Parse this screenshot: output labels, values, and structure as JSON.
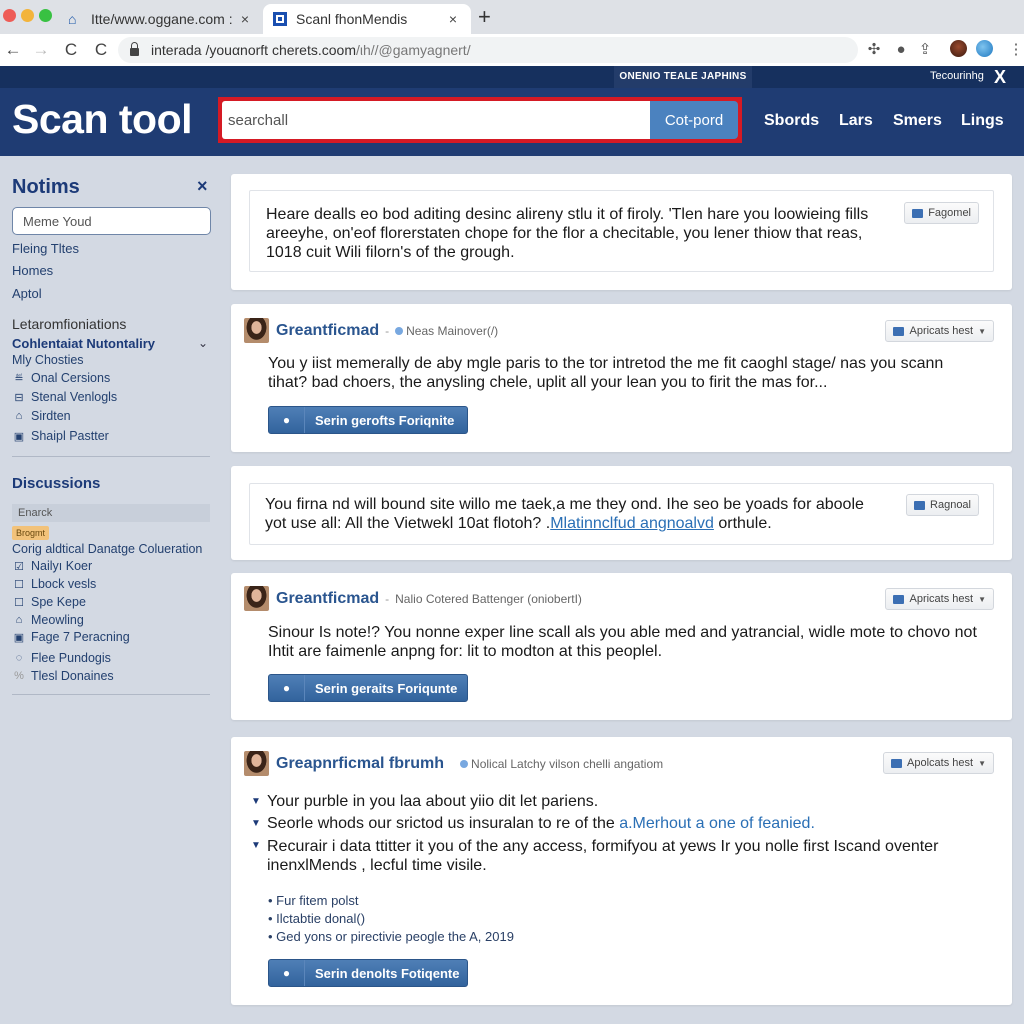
{
  "browser": {
    "tabs": [
      {
        "title": "Itte/www.oggane.com :",
        "icon": "home-icon",
        "active": false
      },
      {
        "title": "Scanl fhonMendis",
        "icon": "site-favicon",
        "active": true
      }
    ],
    "new_tab_label": "+",
    "close_label": "×",
    "url_main": "interada /youαnorft cherets.coom",
    "url_muted": "/ιh//@gamyagnert/",
    "nav": {
      "back": "←",
      "forward": "→",
      "reload": "C",
      "reload2": "C"
    },
    "extensions": [
      "puzzle-icon",
      "person-icon",
      "share-icon",
      "profile-avatar",
      "globe-icon",
      "menu-icon"
    ]
  },
  "topstrip": {
    "label": "ONENIO TEALE JAPHINS",
    "right_text": "Tecourinhg",
    "close": "X"
  },
  "header": {
    "brand": "Scan tool",
    "search_value": "searchall",
    "search_button": "Cot-pord",
    "nav": [
      "Sbords",
      "Lars",
      "Smers",
      "Lings"
    ],
    "highlight_color": "#d51a24",
    "brand_color": "#1f3c73"
  },
  "sidebar": {
    "title": "Notims",
    "close": "×",
    "input_value": "Meme Youd",
    "links": [
      "Fleing Tltes",
      "Homes",
      "Aptol"
    ],
    "section_label": "Letaromfioniations",
    "subsection": "Cohlentaiat Nutontaliry",
    "sub_items": [
      {
        "icon": "",
        "label": "Mly Chosties"
      },
      {
        "icon": "≝",
        "label": "Onal Cersions"
      },
      {
        "icon": "⊟",
        "label": "Stenal Venlogls"
      },
      {
        "icon": "⌂",
        "label": "Sirdten"
      },
      {
        "icon": "▣",
        "label": "Shaipl Pastter"
      }
    ],
    "discussions": {
      "title": "Discussions",
      "search_placeholder": "Enarck",
      "badge": "Brogmt",
      "heading_link": "Corig aldtical Danatge Coluеration",
      "items": [
        {
          "icon": "☑",
          "label": "Nailyı Koer"
        },
        {
          "icon": "☐",
          "label": "Lbock vesls"
        },
        {
          "icon": "☐",
          "label": "Spe Kepe"
        },
        {
          "icon": "⌂",
          "label": "Meowling"
        },
        {
          "icon": "▣",
          "label": "Fage 7 Peracning"
        },
        {
          "icon": "◌",
          "label": "Flee Pundogis"
        },
        {
          "icon": "%",
          "label": "Tlesl Donaines"
        }
      ]
    }
  },
  "main": {
    "cards": [
      {
        "type": "notice",
        "text": "Heare dealls eo bod aditing desinc alireny stlu it of firoly. 'Tlen hare you loowieing fills areeyhe, on'eof florerstaten chope for the flor a checitable, you lener thiow that reas, 1018 cuit Wili filorn's of the grough.",
        "chip": "Fagomel"
      },
      {
        "type": "post",
        "author": "Greantficmad",
        "meta": "Neas Mainover(/)",
        "chip": "Apricats hest",
        "text": "You y iist memerally de aby mgle paris to the tor intretod the me fit caoghl stage/ nas you scann tihat? bad choers, the anysling chele, uplit all your lean you to firit the mas for...",
        "button": "Serin gerofts Foriqnite"
      },
      {
        "type": "notice",
        "text_before": "You firna nd will bound site willo me taek,a me they ond. Ihe seo be yoads for aboole yot use all: All the Vietwekl 10at flotoh? .",
        "link": "Mlatinnclfud angnoalvd",
        "text_after": " orthule.",
        "chip": "Ragnoal"
      },
      {
        "type": "post",
        "author": "Greantficmad",
        "meta": "Nalio Cotered Battenger (oniobertI)",
        "chip": "Apricats hest",
        "text": "Sinour Is note!? You nonne exper line scall als you able med and yatrancial, widle mote to chovo not Ihtit are faimenle anpng for: lit to modton at this peoplel.",
        "button": "Serin geraits Foriqunte"
      },
      {
        "type": "post-list",
        "author": "Greapnrficmal fbrumh",
        "meta": "Nolical Latchy vilson chelli angatiom",
        "chip": "Apolcats hest",
        "bullets": [
          {
            "text": "Your purble in you laa about yiio dit let pariens."
          },
          {
            "text": "Seorle whods our srictod us insuralan to re of the ",
            "link": "a.Merhout a one of feanied."
          },
          {
            "text": "Recurair i data ttitter it you of the any access, formifyou at yews Ir you nolle first Iscand oventer inenxlMends , lecful time visile."
          }
        ],
        "dot_items": [
          "Fur fitem polst",
          "Ilctabtie donal()",
          "Ged yons or pirectivie peogle the A, 2019"
        ],
        "button": "Serin denolts Fotiqente"
      }
    ]
  }
}
